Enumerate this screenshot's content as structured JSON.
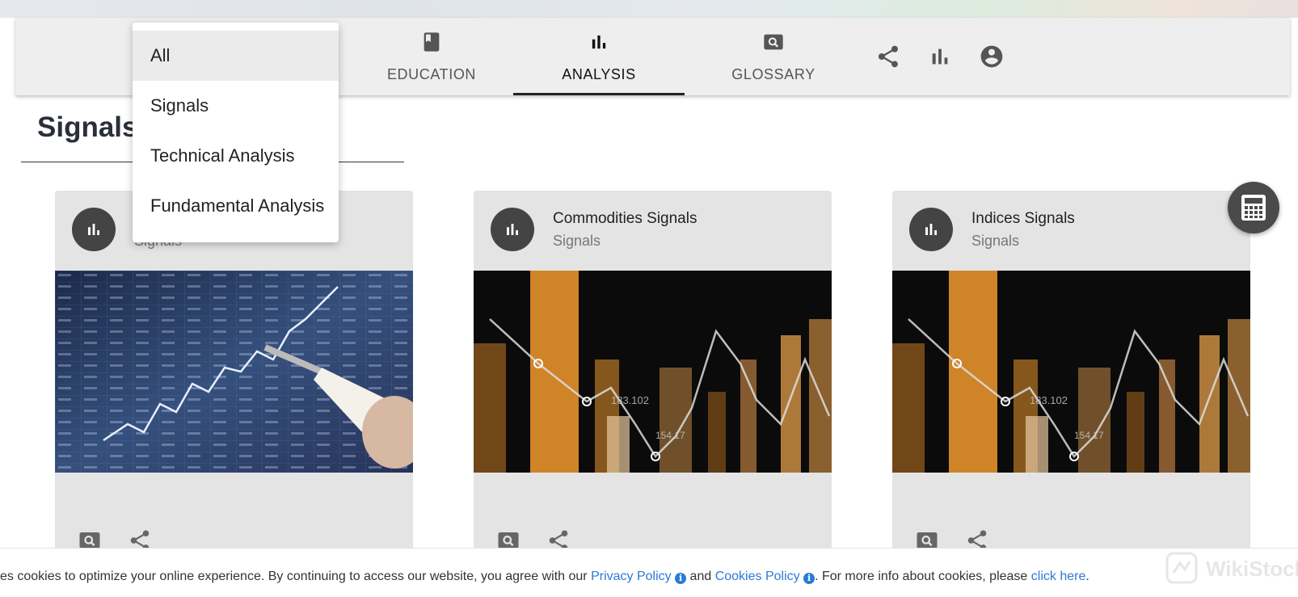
{
  "nav": {
    "tabs": [
      {
        "label": "EDUCATION",
        "icon": "book-icon"
      },
      {
        "label": "ANALYSIS",
        "icon": "bar-chart-icon",
        "active": true
      },
      {
        "label": "GLOSSARY",
        "icon": "search-box-icon"
      }
    ],
    "icons": [
      "share-icon",
      "bar-chart-icon",
      "account-circle-icon"
    ]
  },
  "page": {
    "title": "Signals"
  },
  "filter_menu": {
    "items": [
      "All",
      "Signals",
      "Technical Analysis",
      "Fundamental Analysis"
    ],
    "selected": "All"
  },
  "cards": [
    {
      "title": "",
      "subtitle": "Signals",
      "image": "trading-screen-pen-photo"
    },
    {
      "title": "Commodities Signals",
      "subtitle": "Signals",
      "image": "orange-bar-chart-photo"
    },
    {
      "title": "Indices Signals",
      "subtitle": "Signals",
      "image": "orange-bar-chart-photo"
    }
  ],
  "cookie_banner": {
    "text_start": "es cookies to optimize your online experience. By continuing to access our website, you agree with our ",
    "privacy_link": "Privacy Policy",
    "and_text": " and ",
    "cookies_link": "Cookies Policy",
    "text_end": ". For more info about cookies, please ",
    "click_link": "click here",
    "period": "."
  },
  "watermark": {
    "text": "WikiStock"
  },
  "colors": {
    "accent": "#2b7bd6",
    "nav_bg": "#eeeeee",
    "card_bg": "#e4e4e4",
    "avatar": "#444444",
    "photo_orange": "#f29a2e"
  }
}
